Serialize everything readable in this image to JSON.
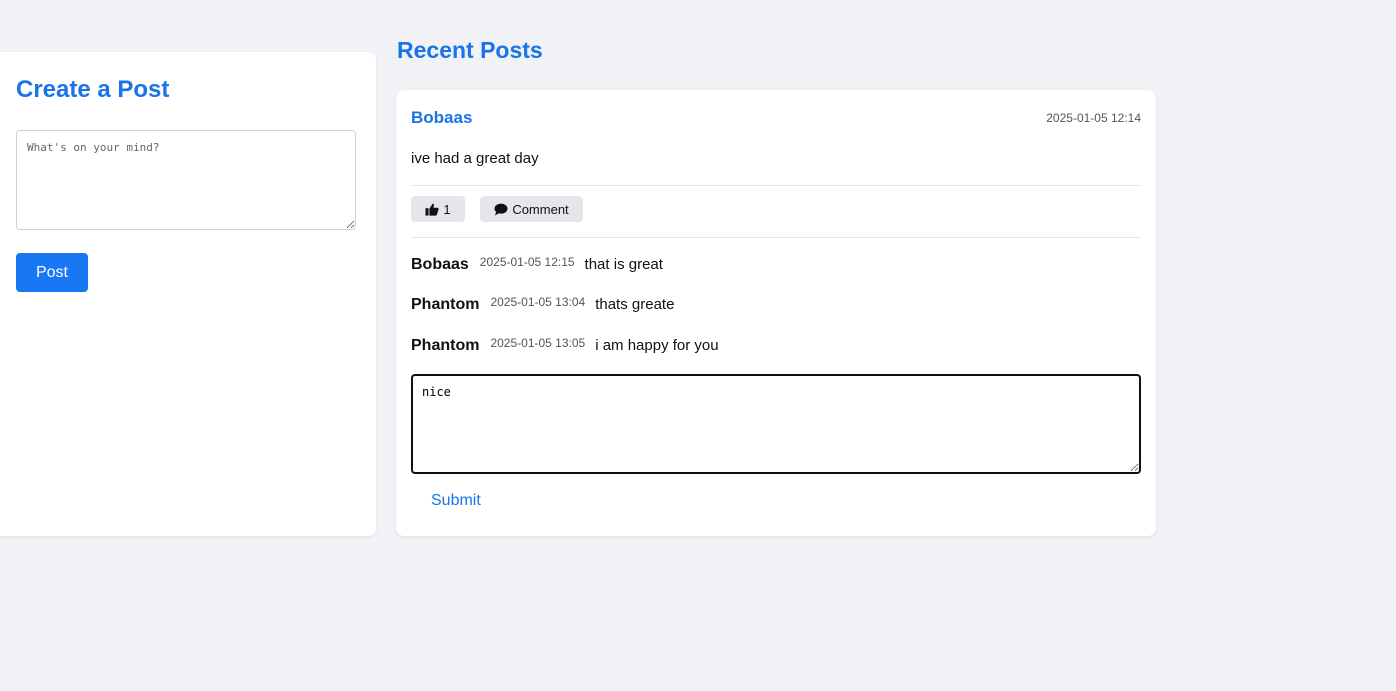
{
  "create_post": {
    "title": "Create a Post",
    "placeholder": "What's on your mind?",
    "value": "",
    "button_label": "Post"
  },
  "recent_posts": {
    "heading": "Recent Posts",
    "posts": [
      {
        "author": "Bobaas",
        "timestamp": "2025-01-05 12:14",
        "content": "ive had a great day",
        "like_count": "1",
        "like_icon": "thumbs-up-icon",
        "comment_label": "Comment",
        "comment_icon": "speech-bubble-icon",
        "comments": [
          {
            "author": "Bobaas",
            "timestamp": "2025-01-05 12:15",
            "text": "that is great"
          },
          {
            "author": "Phantom",
            "timestamp": "2025-01-05 13:04",
            "text": "thats greate"
          },
          {
            "author": "Phantom",
            "timestamp": "2025-01-05 13:05",
            "text": "i am happy for you"
          }
        ],
        "comment_input_value": "nice",
        "submit_label": "Submit"
      }
    ]
  },
  "colors": {
    "accent": "#1a73e8",
    "post_button": "#1877f2",
    "background": "#f0f2f5",
    "action_button_bg": "#e4e6eb"
  }
}
